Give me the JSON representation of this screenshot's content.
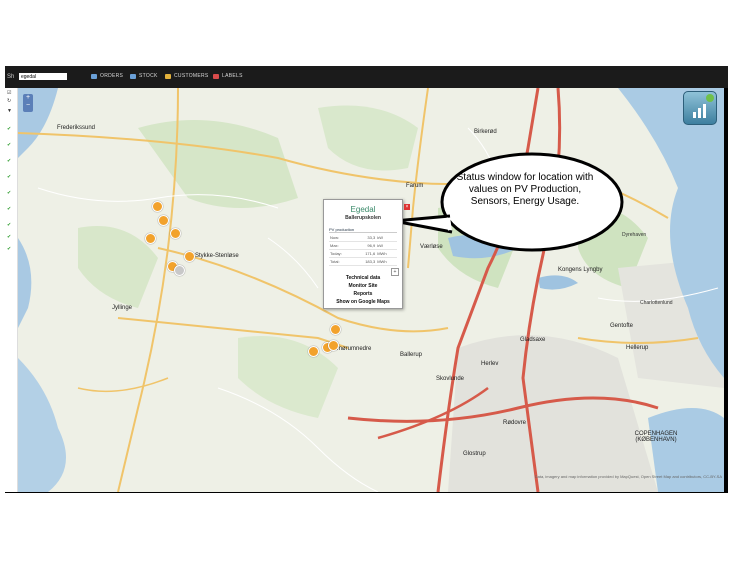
{
  "topbar": {
    "search_label": "Sh",
    "search_value": "egedal",
    "nav": [
      {
        "label": "ORDERS",
        "icon": "orders-icon",
        "color": "#6aa0d8"
      },
      {
        "label": "STOCK",
        "icon": "stock-icon",
        "color": "#6aa0d8"
      },
      {
        "label": "CUSTOMERS",
        "icon": "customers-icon",
        "color": "#e3b23c"
      },
      {
        "label": "LABELS",
        "icon": "labels-icon",
        "color": "#d94b4b"
      }
    ]
  },
  "map": {
    "places": [
      {
        "name": "Frederikssund",
        "big": true
      },
      {
        "name": "Birkerød",
        "big": true
      },
      {
        "name": "Farum",
        "big": true
      },
      {
        "name": "Stykke-Stenløse",
        "big": true
      },
      {
        "name": "Værløse",
        "big": true
      },
      {
        "name": "Kongens Lyngby",
        "big": true
      },
      {
        "name": "Jyllinge",
        "big": true
      },
      {
        "name": "Smørumnedre",
        "big": true
      },
      {
        "name": "Ballerup",
        "big": true
      },
      {
        "name": "Gladsaxe",
        "big": true
      },
      {
        "name": "Gentofte",
        "big": true
      },
      {
        "name": "Hellerup",
        "big": true
      },
      {
        "name": "Skovlunde",
        "big": true
      },
      {
        "name": "Herlev",
        "big": true
      },
      {
        "name": "Rødovre",
        "big": true
      },
      {
        "name": "Glostrup",
        "big": true
      },
      {
        "name": "COPENHAGEN (KØBENHAVN)",
        "big": true
      },
      {
        "name": "Dyrehaven",
        "big": false
      },
      {
        "name": "Charlottenlund",
        "big": false
      }
    ],
    "attribution": "Data, imagery and map information provided by MapQuest, Open Street Map and contributors, CC-BY-SA"
  },
  "popup": {
    "title": "Egedal",
    "subtitle": "Ballerupskolen",
    "section": "PV production",
    "rows": [
      {
        "label": "Now:",
        "value": "33,3",
        "unit": "kW"
      },
      {
        "label": "Max:",
        "value": "96,9",
        "unit": "kW"
      },
      {
        "label": "Today:",
        "value": "171,6",
        "unit": "MWh"
      },
      {
        "label": "Total:",
        "value": "183,3",
        "unit": "MWh"
      }
    ],
    "links": [
      "Technical data",
      "Monitor Site",
      "Reports",
      "Show on Google Maps"
    ]
  },
  "callout": {
    "text": "Status window for location with values on PV Production, Sensors, Energy Usage."
  }
}
